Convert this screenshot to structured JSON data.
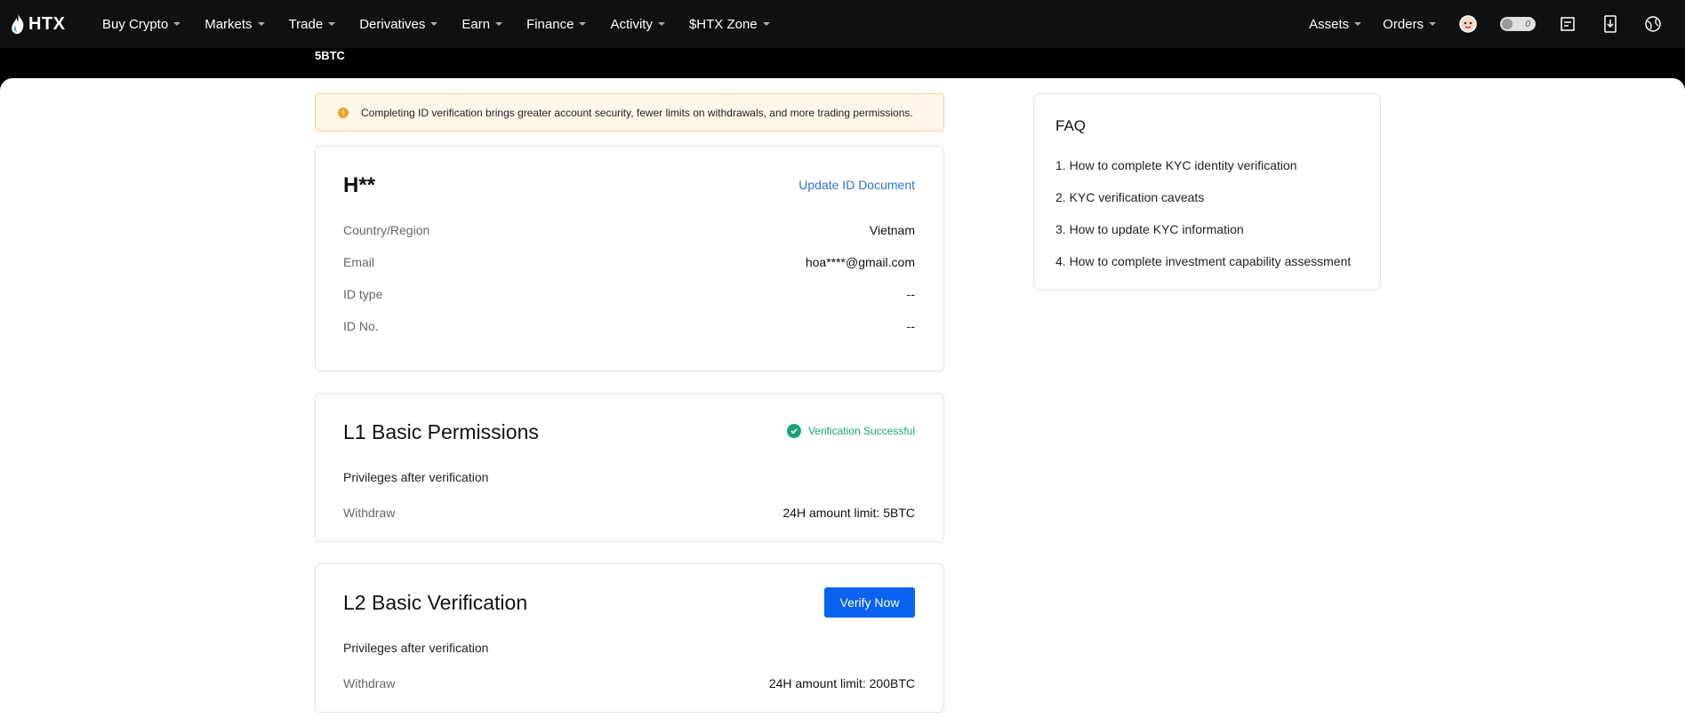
{
  "nav": {
    "logo_text": "HTX",
    "menu": [
      {
        "label": "Buy Crypto"
      },
      {
        "label": "Markets"
      },
      {
        "label": "Trade"
      },
      {
        "label": "Derivatives"
      },
      {
        "label": "Earn"
      },
      {
        "label": "Finance"
      },
      {
        "label": "Activity"
      },
      {
        "label": "$HTX Zone"
      }
    ],
    "right": {
      "assets": "Assets",
      "orders": "Orders",
      "toggle_value": "0"
    }
  },
  "strip_text": "5BTC",
  "notice": {
    "icon": "!",
    "text": "Completing ID verification brings greater account security, fewer limits on withdrawals, and more trading permissions."
  },
  "identity": {
    "name": "H**",
    "update_link": "Update ID Document",
    "rows": [
      {
        "label": "Country/Region",
        "value": "Vietnam"
      },
      {
        "label": "Email",
        "value": "hoa****@gmail.com"
      },
      {
        "label": "ID type",
        "value": "--"
      },
      {
        "label": "ID No.",
        "value": "--"
      }
    ]
  },
  "l1": {
    "title": "L1 Basic Permissions",
    "status": "Verification Successful",
    "subtitle": "Privileges after verification",
    "row_label": "Withdraw",
    "row_value": "24H amount limit: 5BTC"
  },
  "l2": {
    "title": "L2 Basic Verification",
    "button": "Verify Now",
    "subtitle": "Privileges after verification",
    "row_label": "Withdraw",
    "row_value": "24H amount limit: 200BTC"
  },
  "faq": {
    "title": "FAQ",
    "items": [
      "1. How to complete KYC identity verification",
      "2. KYC verification caveats",
      "3. How to update KYC information",
      "4. How to complete investment capability assessment"
    ]
  },
  "colors": {
    "nav_bg": "#0f1014",
    "accent_blue": "#0a63f0",
    "link_blue": "#2d73d8",
    "success_green": "#1aa37a",
    "warning_orange": "#f0a31c"
  }
}
